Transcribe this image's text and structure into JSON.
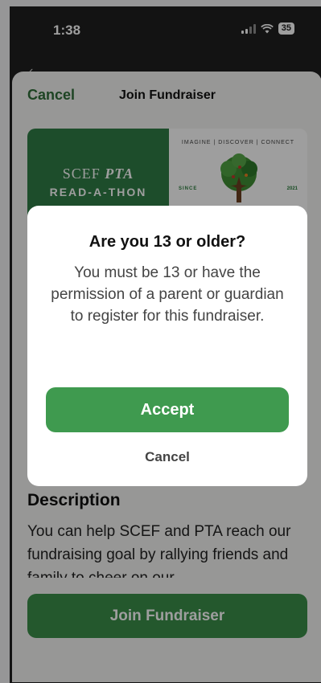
{
  "status_bar": {
    "time": "1:38",
    "battery": "35"
  },
  "sheet": {
    "cancel_label": "Cancel",
    "title": "Join Fundraiser"
  },
  "banner": {
    "org": "SCEF",
    "pta": "PTA",
    "event": "READ-A-THON",
    "motto_words": "IMAGINE | DISCOVER | CONNECT",
    "since": "SINCE",
    "year": "2021"
  },
  "description": {
    "heading": "Description",
    "text": "You can help SCEF and PTA reach our fundraising goal by rallying friends and family to cheer on our"
  },
  "join_button_label": "Join Fundraiser",
  "dialog": {
    "title": "Are you 13 or older?",
    "body": "You must be 13 or have the permission of a parent or guardian to register for this fundraiser.",
    "accept_label": "Accept",
    "cancel_label": "Cancel"
  },
  "colors": {
    "brand_green": "#2f7d46",
    "accept_green": "#3f9a4f"
  }
}
